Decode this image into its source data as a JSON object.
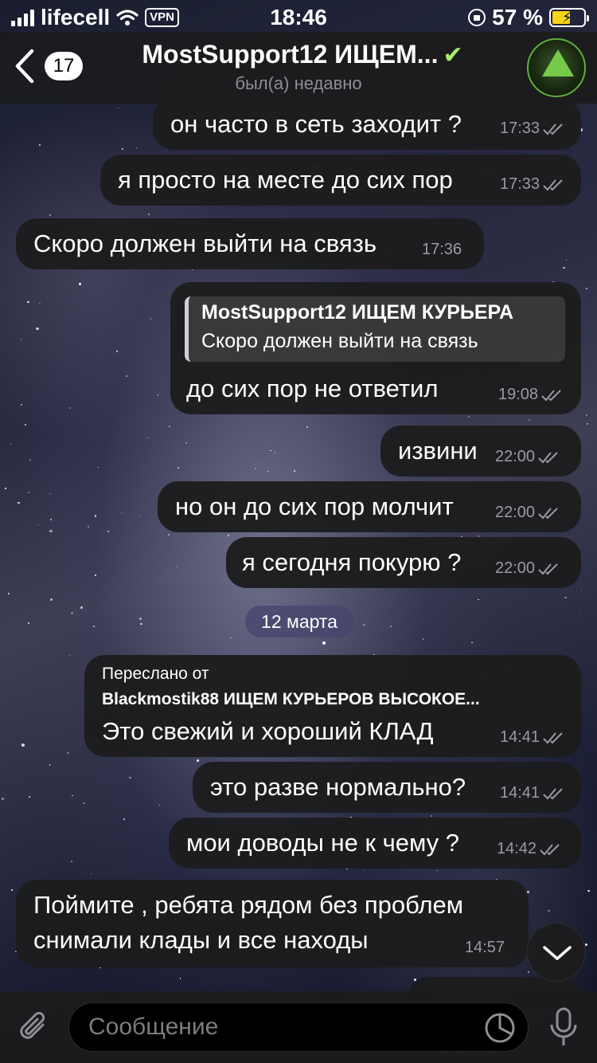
{
  "status_bar": {
    "carrier": "lifecell",
    "vpn": "VPN",
    "time": "18:46",
    "battery": "57 %",
    "battery_level": 0.57
  },
  "header": {
    "back_count": "17",
    "title": "MostSupport12 ИЩЕМ...",
    "subtitle": "был(а) недавно"
  },
  "messages": [
    {
      "text": "он часто в сеть заходит ?",
      "time": "17:33"
    },
    {
      "text": "я просто на месте до сих пор",
      "time": "17:33"
    },
    {
      "text": "Скоро должен выйти на связь",
      "time": "17:36"
    },
    {
      "reply_name": "MostSupport12 ИЩЕМ КУРЬЕРА",
      "reply_text": "Скоро должен выйти на связь",
      "text": "до сих пор не ответил",
      "time": "19:08"
    },
    {
      "text": "извини",
      "time": "22:00"
    },
    {
      "text": "но он до сих пор молчит",
      "time": "22:00"
    },
    {
      "text": "я сегодня покурю ?",
      "time": "22:00"
    },
    {
      "forwarded_label": "Переслано от",
      "forwarded_from": "Blackmostik88 ИЩЕМ КУРЬЕРОВ ВЫСОКОЕ...",
      "text": "Это свежий и хороший КЛАД",
      "time": "14:41"
    },
    {
      "text": "это разве нормально?",
      "time": "14:41"
    },
    {
      "text": "мои доводы не к чему ?",
      "time": "14:42"
    },
    {
      "line1": "Поймите , ребята рядом без проблем",
      "line2": "снимали клады и все находы",
      "time": "14:57"
    }
  ],
  "date_separator": "12 марта",
  "composer": {
    "placeholder": "Сообщение"
  }
}
